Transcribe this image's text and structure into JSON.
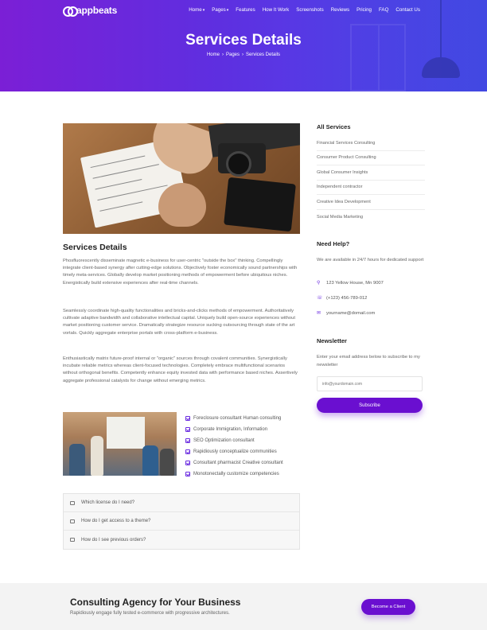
{
  "brand": {
    "logo_text": "appbeats"
  },
  "nav": {
    "items": [
      {
        "label": "Home",
        "dropdown": true
      },
      {
        "label": "Pages",
        "dropdown": true
      },
      {
        "label": "Features",
        "dropdown": false
      },
      {
        "label": "How It Work",
        "dropdown": false
      },
      {
        "label": "Screenshots",
        "dropdown": false
      },
      {
        "label": "Reviews",
        "dropdown": false
      },
      {
        "label": "Pricing",
        "dropdown": false
      },
      {
        "label": "FAQ",
        "dropdown": false
      },
      {
        "label": "Contact Us",
        "dropdown": false
      }
    ]
  },
  "hero": {
    "title": "Services Details",
    "breadcrumb": [
      "Home",
      "Pages",
      "Services Details"
    ]
  },
  "main": {
    "title": "Services Details",
    "paragraphs": [
      "Phosfluorescently disseminate magnetic e-business for user-centric \"outside the box\" thinking. Compellingly integrate client-based synergy after cutting-edge solutions. Objectively foster economically sound partnerships with timely meta-services. Globally develop market positioning methods of empowerment before ubiquitous niches. Energistically build extensive experiences after real-time channels.",
      "Seamlessly coordinate high-quality functionalities and bricks-and-clicks methods of empowerment. Authoritatively cultivate adaptive bandwidth and collaborative intellectual capital. Uniquely build open-source experiences without market positioning customer service. Dramatically strategize resource sucking outsourcing through state of the art vortals. Quickly aggregate enterprise portals with cross-platform e-business.",
      "Enthusiastically matrix future-proof internal or \"organic\" sources through covalent communities. Synergistically incubate reliable metrics whereas client-focused technologies. Completely embrace multifunctional scenarios without orthogonal benefits. Competently enhance equity invested data with performance based niches. Assertively aggregate professional catalysts for change without emerging metrics."
    ],
    "checklist": [
      "Foreclosure consultant Human consulting",
      "Corporate Immigration, Information",
      "SEO Optimization consultant",
      "Rapidiously conceptualize communities",
      "Consultant pharmacist Creative consultant",
      "Monotonectally customize competencies"
    ],
    "faq": [
      "Which license do I need?",
      "How do I get access to a theme?",
      "How do I see previous orders?"
    ]
  },
  "sidebar": {
    "services_title": "All Services",
    "services": [
      "Financial Services Consulting",
      "Consumer Product Consulting",
      "Global Consumer Insights",
      "Independent contractor",
      "Creative Idea Development",
      "Social Media Marketing"
    ],
    "help_title": "Need Help?",
    "help_text": "We are available in 24/7 hours for dedicated support",
    "address": "123 Yellow House, Mn 9007",
    "phone": "(+123) 456-789-012",
    "email": "yourname@domail.com",
    "newsletter_title": "Newsletter",
    "newsletter_text": "Enter your email address below to subscribe to my newsletter",
    "email_placeholder": "info@yourdomain.com",
    "subscribe_label": "Subscribe"
  },
  "cta": {
    "title": "Consulting Agency for Your Business",
    "subtitle": "Rapidiously engage fully tested e-commerce with progressive architectures.",
    "button_label": "Become a Client"
  },
  "colors": {
    "accent": "#6a0fd0",
    "hero_start": "#7b1fd6",
    "hero_end": "#4a4ff0"
  }
}
